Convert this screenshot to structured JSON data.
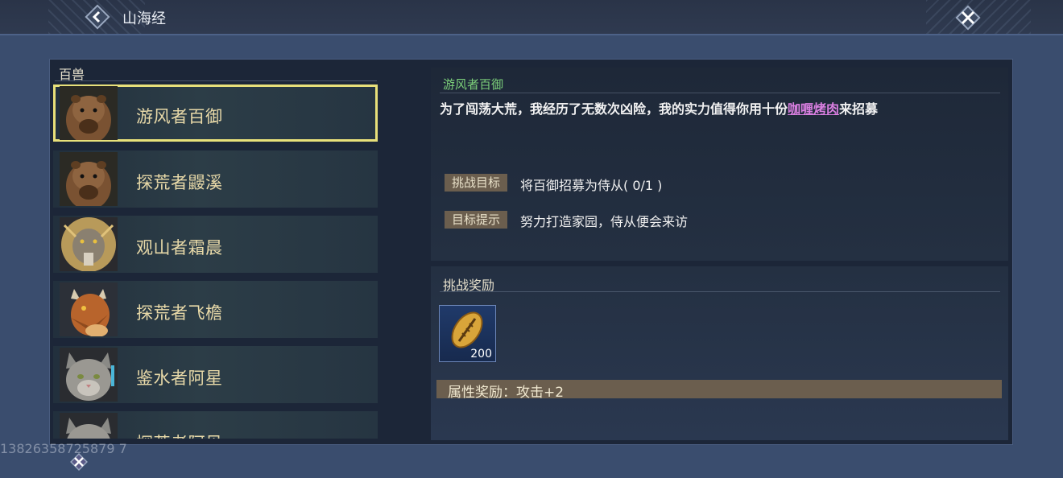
{
  "window": {
    "title": "山海经"
  },
  "colors": {
    "selected_border": "#e8e07a",
    "name_text": "#e8d9a8",
    "hero_title": "#7cd07a",
    "highlight": "#d97fe0",
    "tag_bg": "#6b5e4e"
  },
  "list": {
    "header": "百兽",
    "items": [
      {
        "name": "游风者百御",
        "portrait": "capybara",
        "selected": true
      },
      {
        "name": "探荒者鼹溪",
        "portrait": "capybara",
        "selected": false
      },
      {
        "name": "观山者霜晨",
        "portrait": "lion",
        "selected": false
      },
      {
        "name": "探荒者飞檐",
        "portrait": "dragon",
        "selected": false
      },
      {
        "name": "鉴水者阿星",
        "portrait": "cat",
        "selected": false
      },
      {
        "name": "探荒者阿贝",
        "portrait": "cat",
        "selected": false
      }
    ]
  },
  "detail": {
    "name": "游风者百御",
    "desc_before": "为了闯荡大荒，我经历了无数次凶险，我的实力值得你用十份",
    "desc_highlight": "咖喱烤肉",
    "desc_after": "来招募",
    "goal_label": "挑战目标",
    "goal_value": "将百御招募为侍从( 0/1 )",
    "hint_label": "目标提示",
    "hint_value": "努力打造家园，侍从便会来访"
  },
  "reward": {
    "title": "挑战奖励",
    "item_icon": "golden-seed-icon",
    "item_count": "200",
    "attr": "属性奖励：攻击+2"
  },
  "watermark": "13826358725879 7"
}
